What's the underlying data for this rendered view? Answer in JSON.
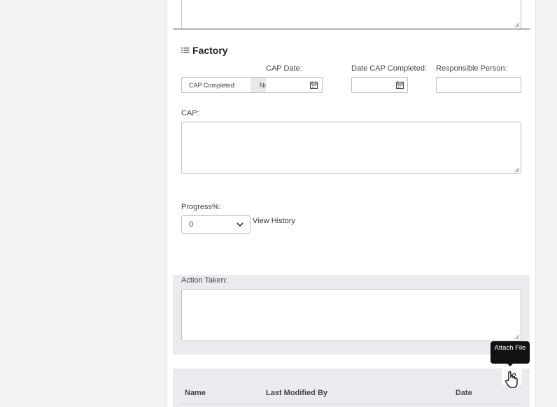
{
  "section": {
    "title": "Factory",
    "icon": "list-icon"
  },
  "fields": {
    "cap_date_label": "CAP Date:",
    "date_cap_completed_label": "Date CAP Completed:",
    "responsible_person_label": "Responsible Person:",
    "cap_completed_label": "CAP Completed:",
    "cap_completed_value": "No",
    "cap_label": "CAP:",
    "progress_label": "Progress%:",
    "progress_value": "0",
    "view_history": "View History",
    "action_taken_label": "Action Taken:"
  },
  "attachments": {
    "tooltip": "Attach File",
    "columns": [
      "Name",
      "Last Modified By",
      "Date"
    ]
  },
  "colors": {
    "panel": "#ffffff",
    "background": "#f2f2f2",
    "gray_section": "#eaebee",
    "tooltip": "#111111"
  }
}
